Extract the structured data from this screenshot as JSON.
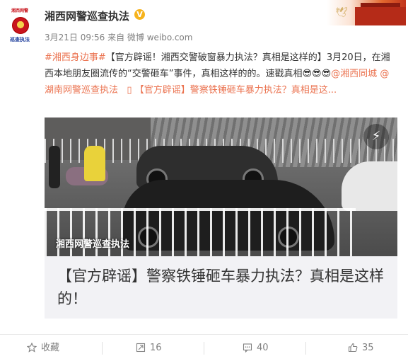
{
  "header": {
    "avatar_caption_top": "湘西网警",
    "avatar_caption_bottom": "巡查执法",
    "account_name": "湘西网警巡查执法",
    "verified_mark": "V",
    "meta": "3月21日 09:56 来自 微博 weibo.com"
  },
  "post": {
    "topic": "#湘西身边事#",
    "headline": "【官方辟谣！湘西交警破窗暴力执法？真相是这样的】",
    "body": "3月20日，在湘西本地朋友圈流传的“交警砸车”事件，真相这样的的。速戳真相",
    "emoji": "😎😎😎",
    "mention1": "@湘西同城",
    "mention2": "@湖南网警巡查执法",
    "link_text": "【官方辟谣】警察铁锤砸车暴力执法？真相是这...",
    "link_icon": "web-link-icon"
  },
  "media": {
    "watermark": "湘西网警巡查执法",
    "flash_icon": "lightning-icon"
  },
  "link_card": {
    "title": "【官方辟谣】警察铁锤砸车暴力执法？真相是这样的！"
  },
  "actions": {
    "favorite_label": "收藏",
    "repost_count": "16",
    "comment_count": "40",
    "like_count": "35"
  },
  "colors": {
    "link": "#eb7350",
    "text": "#333333",
    "muted": "#808080",
    "verified": "#f6b31c"
  }
}
